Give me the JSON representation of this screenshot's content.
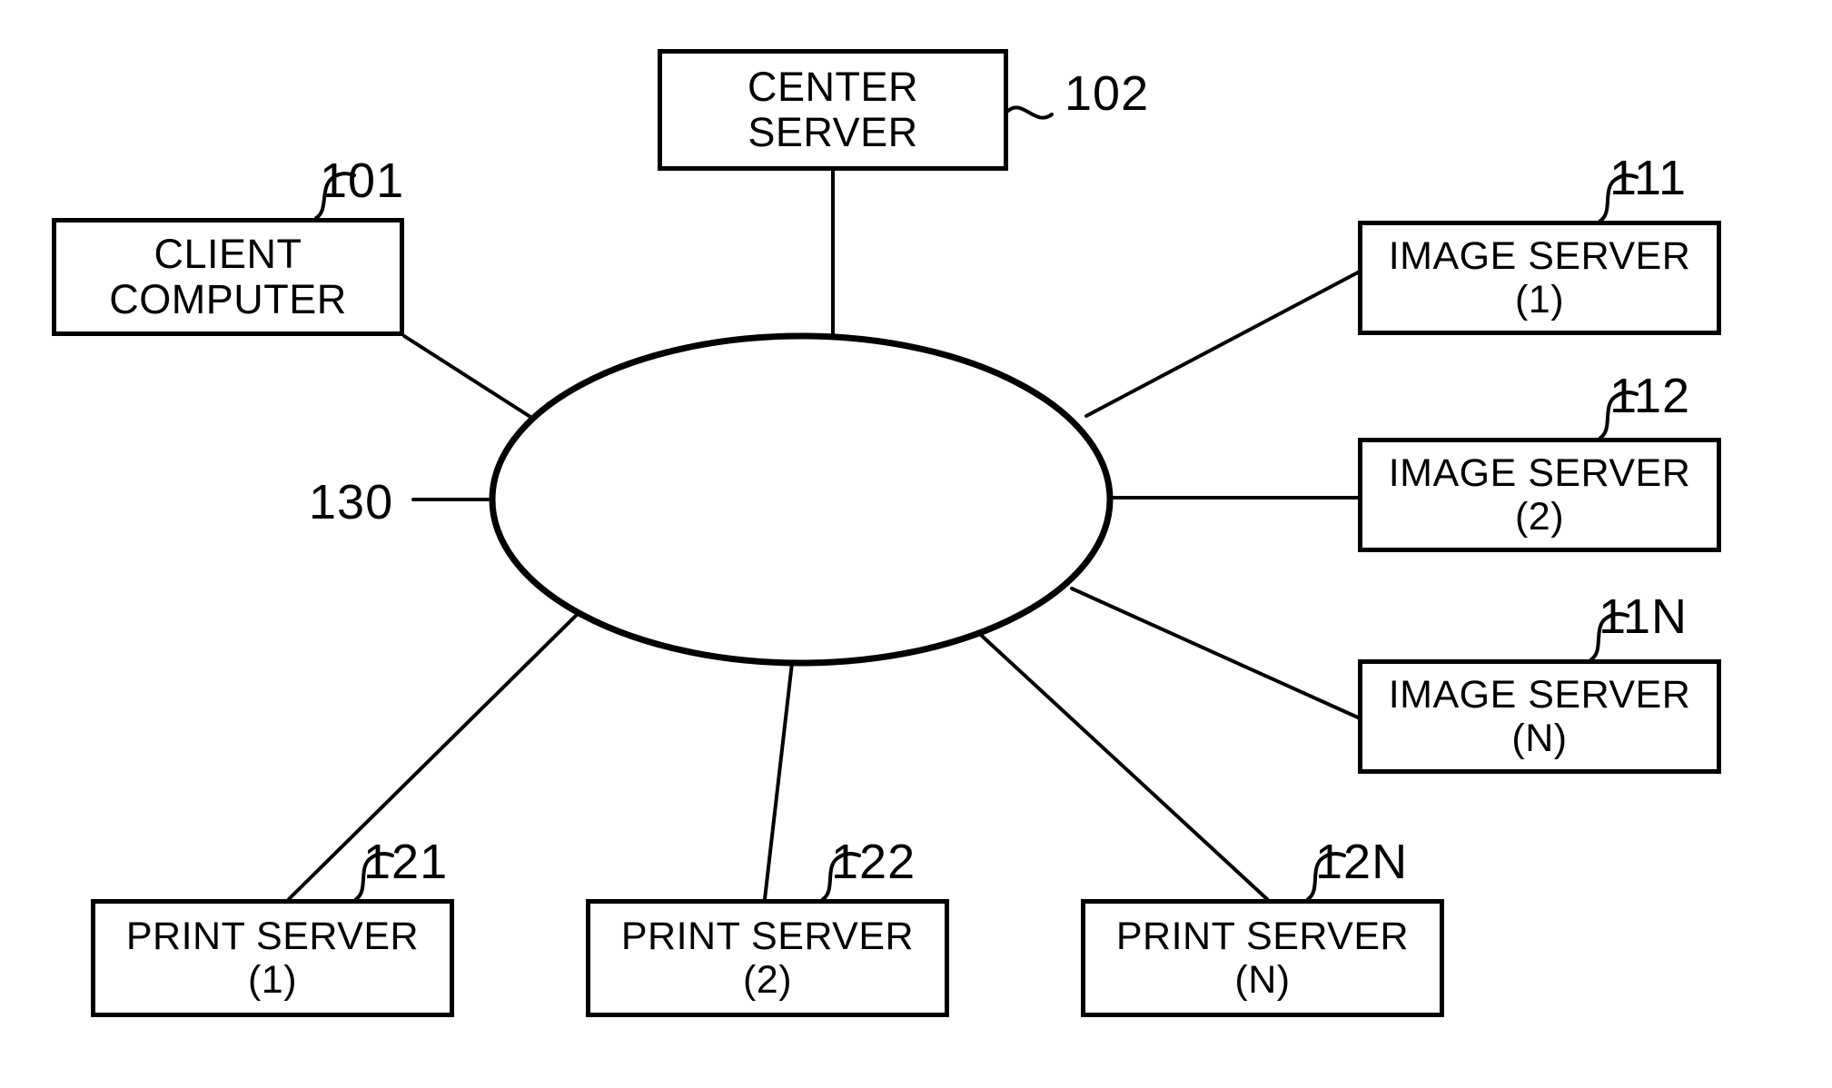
{
  "figure": {
    "title": "Network system block diagram",
    "ink_color": "#000000",
    "background_color": "#ffffff"
  },
  "network": {
    "name": "network-cloud",
    "ref": "130",
    "shape": "ellipse"
  },
  "nodes": [
    {
      "id": "center-server",
      "line1": "CENTER",
      "line2": "SERVER",
      "ref": "102"
    },
    {
      "id": "client-computer",
      "line1": "CLIENT",
      "line2": "COMPUTER",
      "ref": "101"
    },
    {
      "id": "image-server-1",
      "line1": "IMAGE SERVER",
      "line2": "(1)",
      "ref": "111"
    },
    {
      "id": "image-server-2",
      "line1": "IMAGE SERVER",
      "line2": "(2)",
      "ref": "112"
    },
    {
      "id": "image-server-n",
      "line1": "IMAGE SERVER",
      "line2": "(N)",
      "ref": "11N"
    },
    {
      "id": "print-server-1",
      "line1": "PRINT SERVER",
      "line2": "(1)",
      "ref": "121"
    },
    {
      "id": "print-server-2",
      "line1": "PRINT SERVER",
      "line2": "(2)",
      "ref": "122"
    },
    {
      "id": "print-server-n",
      "line1": "PRINT SERVER",
      "line2": "(N)",
      "ref": "12N"
    }
  ]
}
